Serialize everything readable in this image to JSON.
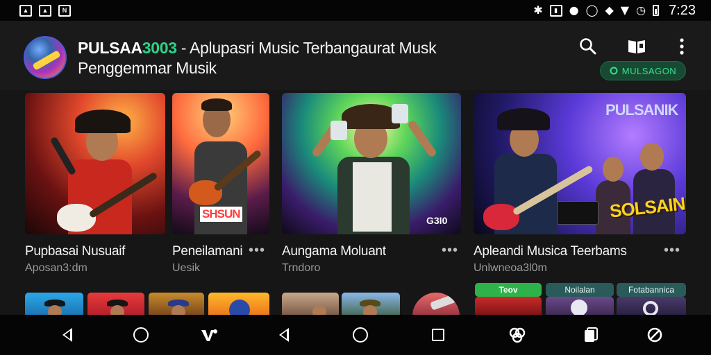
{
  "status_bar": {
    "left_icons": [
      "image-icon",
      "gallery-icon",
      "nfc-icon"
    ],
    "right_icons": [
      "bluetooth-icon",
      "vibrate-icon",
      "location-icon",
      "alarm-icon",
      "data-icon",
      "wifi-icon",
      "alarm-clock-icon",
      "battery-icon"
    ],
    "time": "7:23"
  },
  "header": {
    "brand": "PULSAA",
    "brand_num": "3003",
    "title_rest": " - Aplupasri Music Terbangaurat Musk Penggemmar Musik",
    "badge_label": "MULSAGON",
    "icons": [
      "search-icon",
      "book-icon",
      "more-vert-icon"
    ]
  },
  "cards": [
    {
      "title": "Pupbasai Nusuaif",
      "subtitle": "Aposan3:dm",
      "more": "",
      "thumb_badge": ""
    },
    {
      "title": "Peneilamani",
      "subtitle": "Uesik",
      "more": "•••",
      "thumb_badge": "SHSUN"
    },
    {
      "title": "Aungama Moluant",
      "subtitle": "Trndoro",
      "more": "•••",
      "thumb_badge": "G3I0"
    },
    {
      "title": "Apleandi Musica Teerbams",
      "subtitle": "Unlwneoa3l0m",
      "more": "•••",
      "thumb_badge": "SOLSAIN",
      "thumb_overlay": "PULSANIK"
    }
  ],
  "chips": [
    "Teov",
    "Noilalan",
    "Fotabannica"
  ],
  "colors": {
    "accent": "#2fd38a",
    "badge_bg": "#174a33",
    "background": "#161616",
    "status_bar": "#050505"
  },
  "nav_bar": {
    "icons": [
      "back-icon",
      "home-icon",
      "app-icon",
      "back-icon",
      "home-icon",
      "recents-icon",
      "assistant-icon",
      "copy-icon",
      "sync-icon"
    ]
  }
}
